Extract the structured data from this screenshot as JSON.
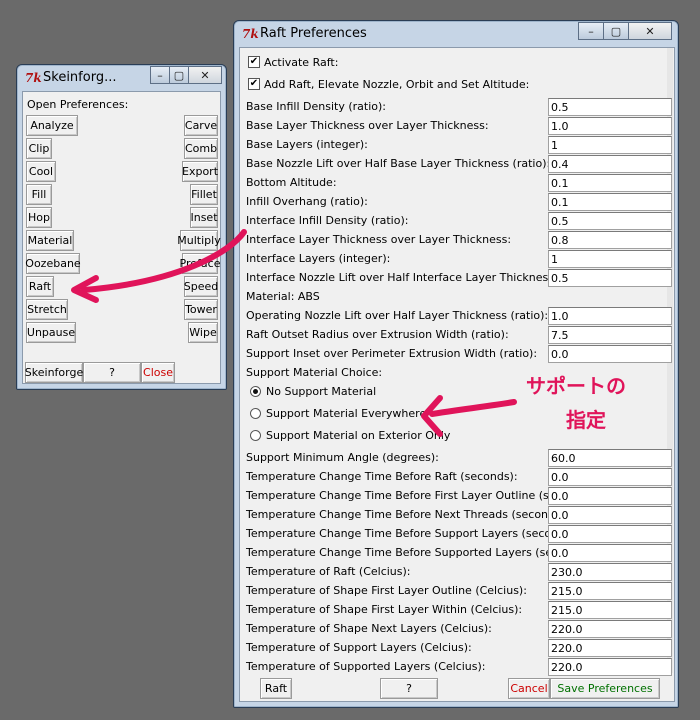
{
  "small_window": {
    "title": "Skeinforg...",
    "heading": "Open Preferences:",
    "left_buttons": [
      "Analyze",
      "Clip",
      "Cool",
      "Fill",
      "Hop",
      "Material",
      "Oozebane",
      "Raft",
      "Stretch",
      "Unpause"
    ],
    "right_buttons": [
      "Carve",
      "Comb",
      "Export",
      "Fillet",
      "Inset",
      "Multiply",
      "Preface",
      "Speed",
      "Tower",
      "Wipe"
    ],
    "bottom": {
      "skeinforge": "Skeinforge",
      "help": "?",
      "close": "Close"
    }
  },
  "raft_window": {
    "title": "Raft Preferences",
    "checkboxes": [
      {
        "label": "Activate Raft:",
        "checked": true
      },
      {
        "label": "Add Raft, Elevate Nozzle, Orbit and Set Altitude:",
        "checked": true
      }
    ],
    "fields_a": [
      {
        "label": "Base Infill Density (ratio):",
        "value": "0.5"
      },
      {
        "label": "Base Layer Thickness over Layer Thickness:",
        "value": "1.0"
      },
      {
        "label": "Base Layers (integer):",
        "value": "1"
      },
      {
        "label": "Base Nozzle Lift over Half Base Layer Thickness (ratio):",
        "value": "0.4"
      },
      {
        "label": "Bottom Altitude:",
        "value": "0.1"
      },
      {
        "label": "Infill Overhang (ratio):",
        "value": "0.1"
      },
      {
        "label": "Interface Infill Density (ratio):",
        "value": "0.5"
      },
      {
        "label": "Interface Layer Thickness over Layer Thickness:",
        "value": "0.8"
      },
      {
        "label": "Interface Layers (integer):",
        "value": "1"
      },
      {
        "label": "Interface Nozzle Lift over Half Interface Layer Thickness (ratio):",
        "value": "0.5"
      }
    ],
    "material_label": "Material: ABS",
    "fields_b": [
      {
        "label": "Operating Nozzle Lift over Half Layer Thickness (ratio):",
        "value": "1.0"
      },
      {
        "label": "Raft Outset Radius over Extrusion Width (ratio):",
        "value": "7.5"
      },
      {
        "label": "Support Inset over Perimeter Extrusion Width (ratio):",
        "value": "0.0"
      }
    ],
    "support_choice_label": "Support Material Choice:",
    "radios": [
      {
        "label": "No Support Material",
        "selected": true
      },
      {
        "label": "Support Material Everywhere",
        "selected": false
      },
      {
        "label": "Support Material on Exterior Only",
        "selected": false
      }
    ],
    "fields_c": [
      {
        "label": "Support Minimum Angle (degrees):",
        "value": "60.0"
      },
      {
        "label": "Temperature Change Time Before Raft (seconds):",
        "value": "0.0"
      },
      {
        "label": "Temperature Change Time Before First Layer Outline (seconds):",
        "value": "0.0"
      },
      {
        "label": "Temperature Change Time Before Next Threads (seconds):",
        "value": "0.0"
      },
      {
        "label": "Temperature Change Time Before Support Layers (seconds):",
        "value": "0.0"
      },
      {
        "label": "Temperature Change Time Before Supported Layers (seconds):",
        "value": "0.0"
      },
      {
        "label": "Temperature of Raft (Celcius):",
        "value": "230.0"
      },
      {
        "label": "Temperature of Shape First Layer Outline (Celcius):",
        "value": "215.0"
      },
      {
        "label": "Temperature of Shape First Layer Within (Celcius):",
        "value": "215.0"
      },
      {
        "label": "Temperature of Shape Next Layers (Celcius):",
        "value": "220.0"
      },
      {
        "label": "Temperature of Support Layers (Celcius):",
        "value": "220.0"
      },
      {
        "label": "Temperature of Supported Layers (Celcius):",
        "value": "220.0"
      }
    ],
    "bottom": {
      "raft": "Raft",
      "help": "?",
      "cancel": "Cancel",
      "save": "Save Preferences"
    }
  },
  "annotation": {
    "text_line1": "サポートの",
    "text_line2": "指定",
    "color": "#e0145a"
  },
  "colors": {
    "cancel": "#cc0000",
    "save": "#007000",
    "close": "#cc0000"
  }
}
